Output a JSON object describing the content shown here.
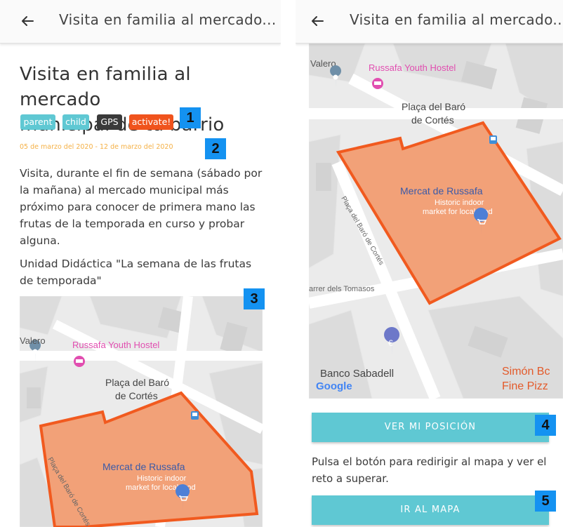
{
  "left_screen": {
    "appbar": {
      "title": "Visita en familia al mercado..."
    },
    "title_line1": "Visita en familia al mercado",
    "title_line2": "municipal de tu barrio",
    "tags": [
      "parent",
      "child",
      "GPS",
      "activate!"
    ],
    "dates": "05 de marzo del 2020 - 12 de marzo del 2020",
    "description_lines": [
      "Visita, durante el fin de semana (sábado por",
      "la mañana) al mercado municipal más",
      "próximo para conocer de primera mano las",
      "frutas de la temporada en curso y probar",
      "alguna."
    ],
    "unit_lines": [
      "Unidad Didáctica \"La semana de las frutas",
      "de temporada\""
    ],
    "map_labels": {
      "valero": "Valero",
      "hostel": "Russafa Youth Hostel",
      "placa_1": "Plaça del Baró",
      "placa_2": "de Cortés",
      "market": "Mercat de Russafa",
      "market_sub_1": "Historic indoor",
      "market_sub_2": "market for local food",
      "street": "Plaça del Baró de Cortés"
    }
  },
  "right_screen": {
    "appbar": {
      "title": "Visita en familia al mercado..."
    },
    "map_labels": {
      "valero": "Valero",
      "hostel": "Russafa Youth Hostel",
      "placa_1": "Plaça del Baró",
      "placa_2": "de Cortés",
      "market": "Mercat de Russafa",
      "market_sub_1": "Historic indoor",
      "market_sub_2": "market for local food",
      "street": "Plaça del Baró de Cortés",
      "street2": "arrer dels Tomasos",
      "bank": "Banco Sabadell",
      "simon_1": "Simón Bc",
      "simon_2": "Fine Pizz",
      "google": "Google"
    },
    "ver_button": "VER MI POSICIÓN",
    "instruction_lines": [
      "Pulsa el botón para redirigir al mapa y ver el",
      "reto a superar."
    ],
    "ir_button": "IR AL MAPA"
  },
  "markers": [
    "1",
    "2",
    "3",
    "4",
    "5"
  ],
  "colors": {
    "accent_cyan": "#5fc8d3",
    "tag_dark": "#3a3a3a",
    "tag_orange": "#f0531d",
    "date_orange": "#f5b044",
    "marker_blue": "#1492f1",
    "map_area_fill": "#f2a178",
    "map_area_stroke": "#f15a1f",
    "hostel_pink": "#e14eb0",
    "poi_blue": "#4d7fd6"
  },
  "icons": {
    "back": "arrow-left-icon",
    "place": "place-pin-icon",
    "hostel": "hostel-pin-icon",
    "shop": "shopping-cart-pin-icon",
    "bank": "euro-pin-icon",
    "transit": "transit-icon"
  }
}
